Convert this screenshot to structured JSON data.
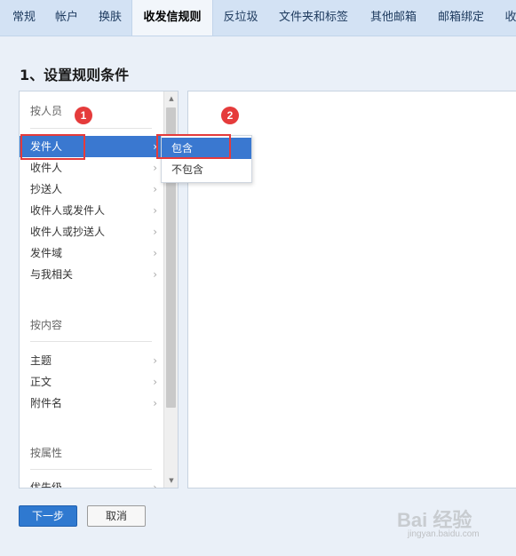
{
  "tabs": [
    {
      "label": "常规",
      "active": false
    },
    {
      "label": "帐户",
      "active": false
    },
    {
      "label": "换肤",
      "active": false
    },
    {
      "label": "收发信规则",
      "active": true
    },
    {
      "label": "反垃圾",
      "active": false
    },
    {
      "label": "文件夹和标签",
      "active": false
    },
    {
      "label": "其他邮箱",
      "active": false
    },
    {
      "label": "邮箱绑定",
      "active": false
    },
    {
      "label": "收",
      "active": false
    }
  ],
  "section_title": "1、设置规则条件",
  "condition_groups": [
    {
      "title": "按人员",
      "items": [
        "发件人",
        "收件人",
        "抄送人",
        "收件人或发件人",
        "收件人或抄送人",
        "发件域",
        "与我相关"
      ]
    },
    {
      "title": "按内容",
      "items": [
        "主题",
        "正文",
        "附件名"
      ]
    },
    {
      "title": "按属性",
      "items": [
        "优先级"
      ]
    }
  ],
  "selected_condition": "发件人",
  "submenu": {
    "items": [
      "包含",
      "不包含"
    ],
    "selected": "包含"
  },
  "annotations": {
    "badge_1": "1",
    "badge_2": "2"
  },
  "buttons": {
    "next": "下一步",
    "cancel": "取消"
  },
  "watermark": {
    "brand": "Bai 经验",
    "url": "jingyan.baidu.com"
  },
  "colors": {
    "accent": "#3a78d0",
    "annotation": "#e53b3b",
    "tabbar": "#d3e2f4"
  }
}
